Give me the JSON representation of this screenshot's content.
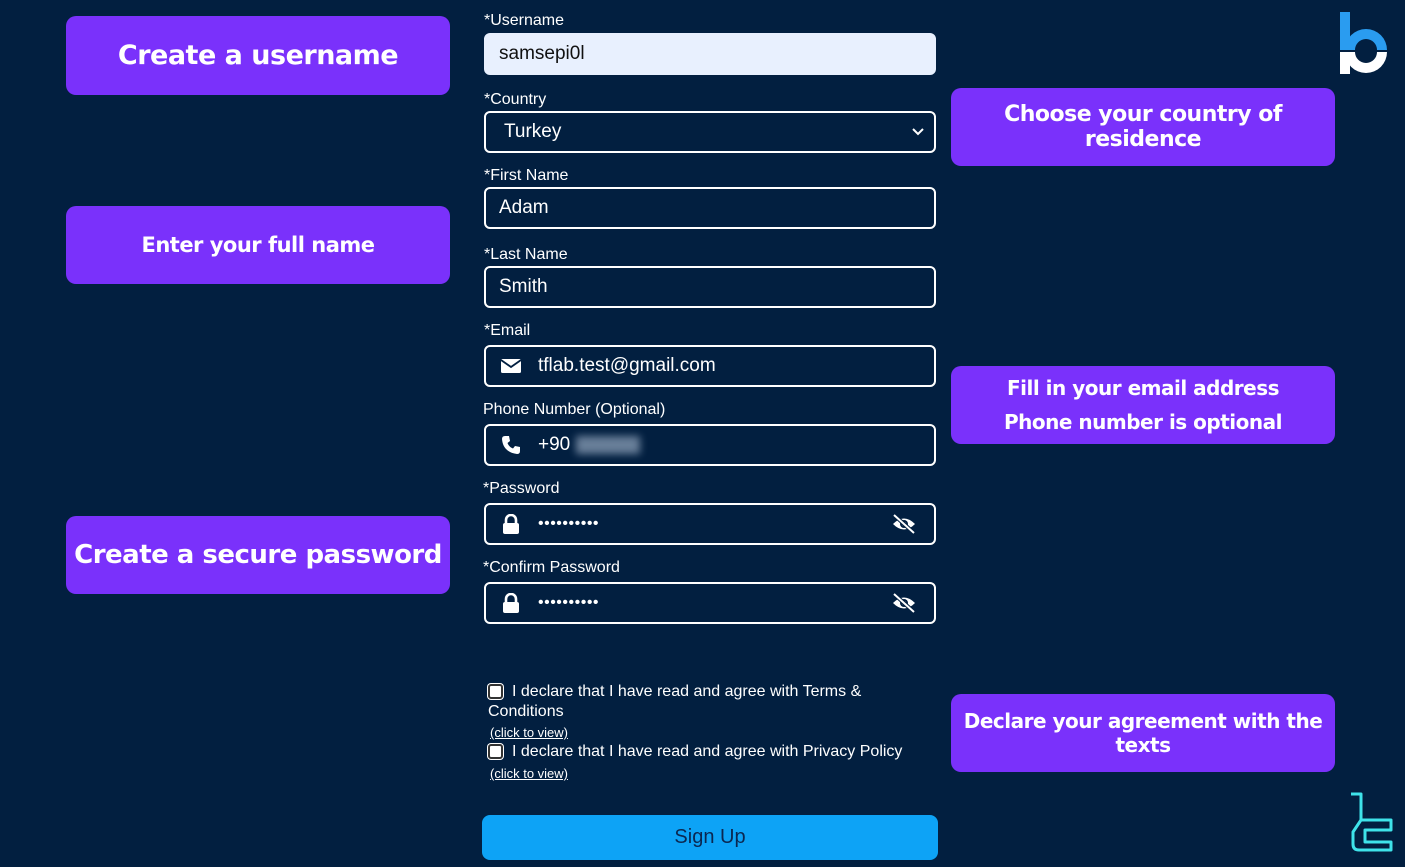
{
  "callouts": {
    "username": "Create a username",
    "full_name": "Enter your full name",
    "password": "Create a secure password",
    "country": "Choose your country of residence",
    "email_line1": "Fill in your email address",
    "email_line2": "Phone number is optional",
    "agreement": "Declare your agreement with the texts"
  },
  "form": {
    "username": {
      "label": "*Username",
      "value": "samsepi0l"
    },
    "country": {
      "label": "*Country",
      "value": "Turkey"
    },
    "first_name": {
      "label": "*First Name",
      "value": "Adam"
    },
    "last_name": {
      "label": "*Last Name",
      "value": "Smith"
    },
    "email": {
      "label": "*Email",
      "value": "tflab.test@gmail.com",
      "icon": "envelope-icon"
    },
    "phone": {
      "label": "Phone Number (Optional)",
      "value": "+90",
      "icon": "phone-icon"
    },
    "password": {
      "label": "*Password",
      "value": "••••••••••",
      "icon": "lock-icon",
      "toggle_icon": "eye-slash-icon"
    },
    "confirm_password": {
      "label": "*Confirm Password",
      "value": "••••••••••",
      "icon": "lock-icon",
      "toggle_icon": "eye-slash-icon"
    },
    "terms": {
      "text_line1": "I declare that I have read and agree with Terms &",
      "text_line2": "Conditions",
      "link": "(click to view)",
      "checked": false
    },
    "privacy": {
      "text": "I declare that I have read and agree with Privacy Policy",
      "link": "(click to view)",
      "checked": false
    },
    "signup_label": "Sign Up"
  },
  "colors": {
    "background": "#021f40",
    "callout": "#7a31fb",
    "signup_button": "#0da3f6",
    "logo_blue": "#2a9cf0",
    "logo_cyan": "#3fe3ea"
  }
}
